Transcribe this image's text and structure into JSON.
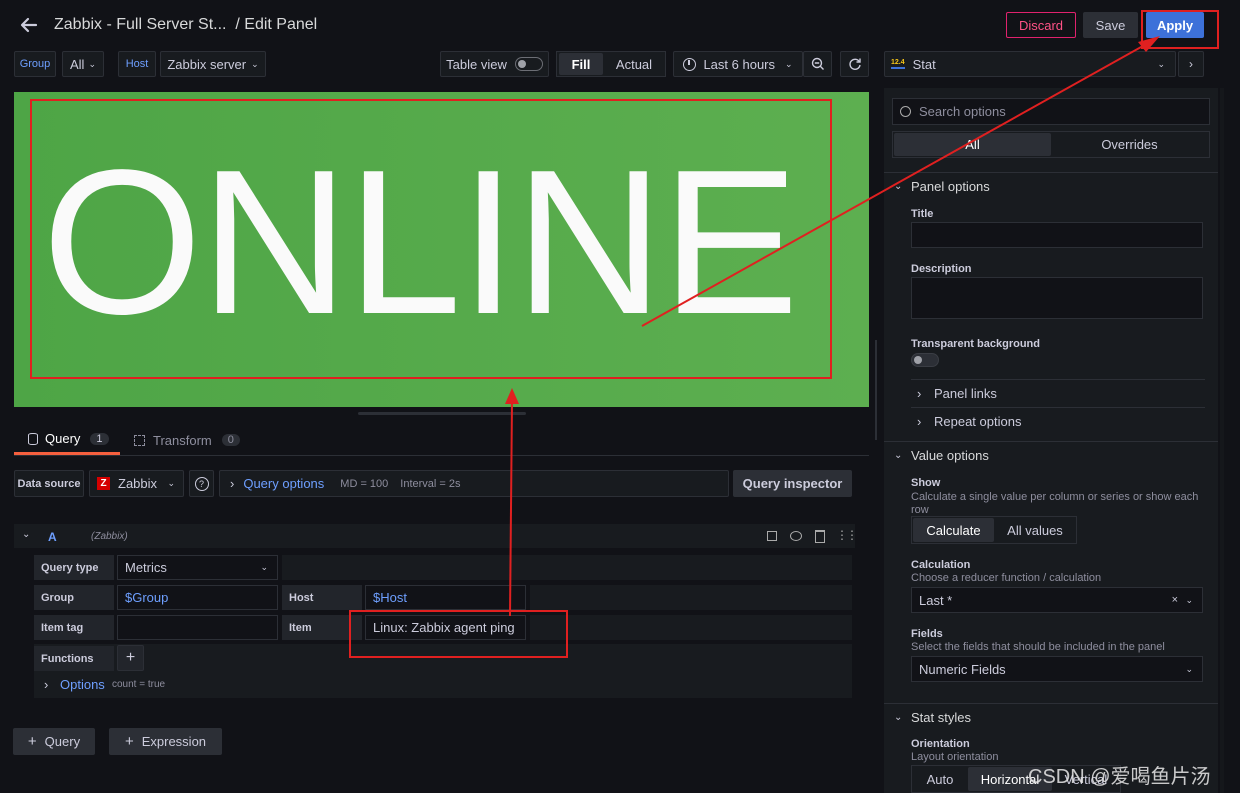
{
  "header": {
    "title": "Zabbix - Full Server St...  / Edit Panel",
    "discard_label": "Discard",
    "save_label": "Save",
    "apply_label": "Apply"
  },
  "toolbar": {
    "group_label": "Group",
    "group_value": "All",
    "host_label": "Host",
    "host_value": "Zabbix server",
    "table_view_label": "Table view",
    "fill_label": "Fill",
    "actual_label": "Actual",
    "time_range": "Last 6 hours",
    "viz_icon_text": "12.4",
    "viz_name": "Stat"
  },
  "panel": {
    "value_text": "ONLINE",
    "bg_color": "#56a64b"
  },
  "tabs": [
    {
      "label": "Query",
      "count": "1"
    },
    {
      "label": "Transform",
      "count": "0"
    }
  ],
  "query_bar": {
    "datasource_label": "Data source",
    "datasource_value": "Zabbix",
    "query_options_label": "Query options",
    "md": "MD = 100",
    "interval": "Interval = 2s",
    "inspector_label": "Query inspector"
  },
  "query_a": {
    "ref": "A",
    "ds": "(Zabbix)",
    "query_type_label": "Query type",
    "query_type_value": "Metrics",
    "group_label": "Group",
    "group_value": "$Group",
    "host_label": "Host",
    "host_value": "$Host",
    "item_tag_label": "Item tag",
    "item_tag_value": "",
    "item_label": "Item",
    "item_value": "Linux: Zabbix agent ping",
    "functions_label": "Functions",
    "options_label": "Options",
    "options_hint": "count = true"
  },
  "bottom_buttons": {
    "query": "Query",
    "expression": "Expression"
  },
  "options_pane": {
    "search_placeholder": "Search options",
    "tab_all": "All",
    "tab_overrides": "Overrides",
    "panel_options": "Panel options",
    "title_label": "Title",
    "description_label": "Description",
    "transparent_label": "Transparent background",
    "panel_links": "Panel links",
    "repeat_options": "Repeat options",
    "value_options": "Value options",
    "show_label": "Show",
    "show_desc": "Calculate a single value per column or series or show each row",
    "calculate": "Calculate",
    "all_values": "All values",
    "calculation_label": "Calculation",
    "calculation_desc": "Choose a reducer function / calculation",
    "calculation_value": "Last *",
    "fields_label": "Fields",
    "fields_desc": "Select the fields that should be included in the panel",
    "fields_value": "Numeric Fields",
    "stat_styles": "Stat styles",
    "orientation_label": "Orientation",
    "orientation_desc": "Layout orientation",
    "auto": "Auto",
    "horizontal": "Horizontal",
    "vertical": "Vertical"
  },
  "watermark": "CSDN @爱喝鱼片汤"
}
